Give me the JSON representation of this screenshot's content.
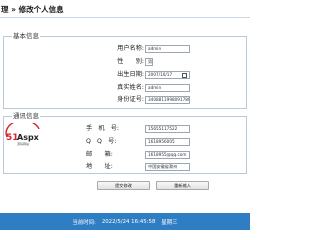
{
  "header": {
    "title": "理 » 修改个人信息"
  },
  "basic_info": {
    "legend": "基本信息",
    "fields": [
      {
        "label": "用户名称:",
        "value": "admin"
      },
      {
        "label": "性　　别:",
        "value": "男"
      },
      {
        "label": "出生日期:",
        "value": "2007/10/17"
      },
      {
        "label": "真实姓名:",
        "value": "admin"
      },
      {
        "label": "身份证号:",
        "value": "340881199809178031"
      }
    ]
  },
  "contact_info": {
    "legend": "通讯信息",
    "fields": [
      {
        "label": "手　机　号:",
        "value": "15655117522"
      },
      {
        "label": "Q　Q　号:",
        "value": "1618956005"
      },
      {
        "label": "邮　　箱:",
        "value": "1618955@qq.com"
      },
      {
        "label": "地　　址:",
        "value": "中国安徽省滁州"
      }
    ]
  },
  "logo": {
    "text_left": "51",
    "text_right": "Aspx",
    "tagline": "源码网站"
  },
  "buttons": {
    "submit": "提交修改",
    "reset": "重新输入"
  },
  "footer": {
    "label": "当前时间:",
    "datetime": "2022/5/24 16:45:58",
    "weekday": "星期三"
  },
  "colors": {
    "footer_bg": "#2f7ec4",
    "border": "#b9c9dc",
    "logo_red": "#d8232a"
  }
}
